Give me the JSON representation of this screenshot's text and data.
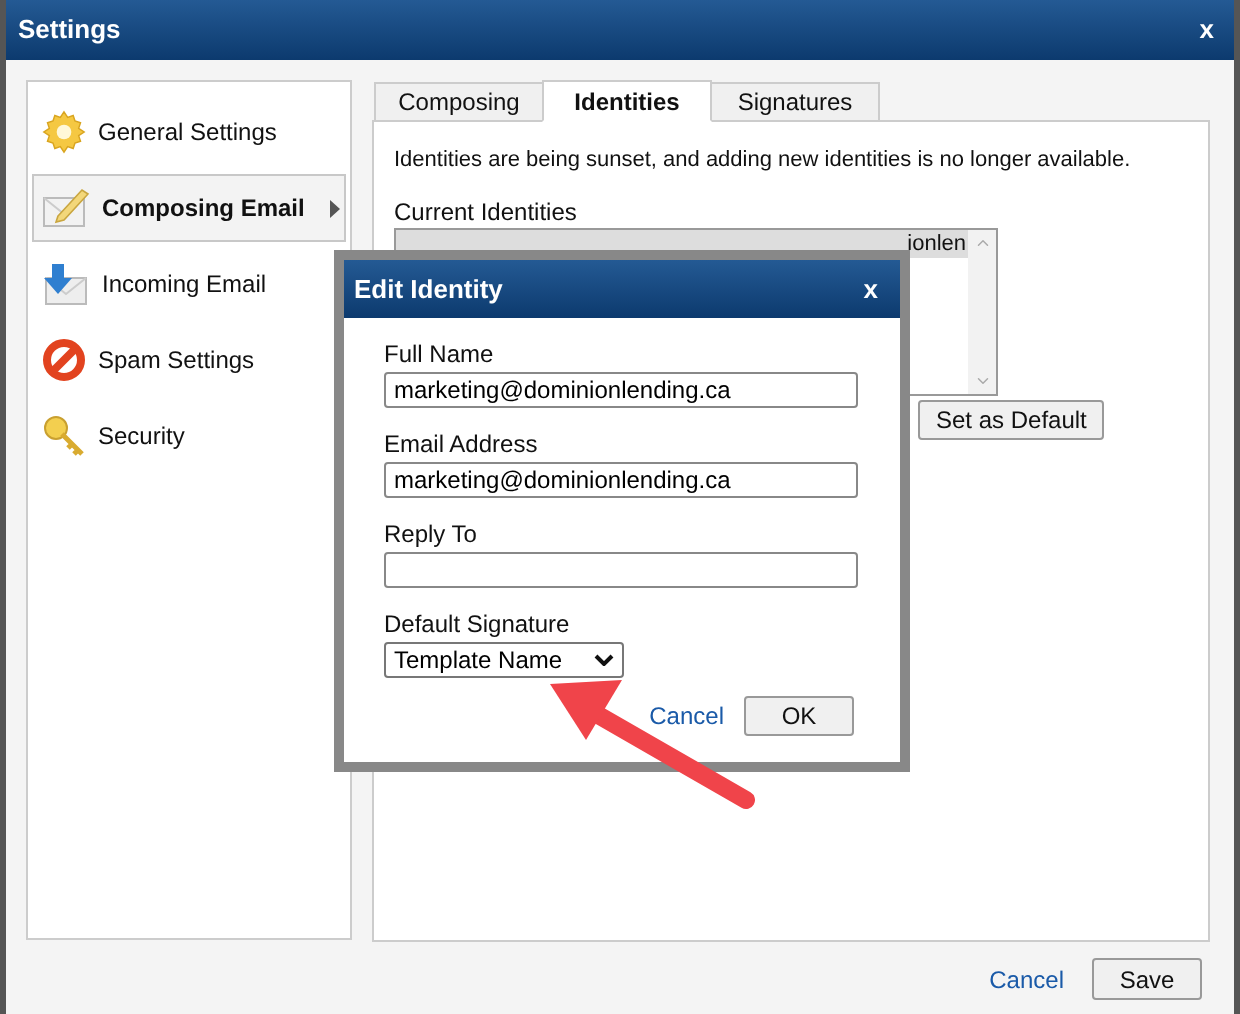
{
  "window": {
    "title": "Settings",
    "close": "x"
  },
  "sidebar": {
    "items": [
      {
        "label": "General Settings",
        "selected": false
      },
      {
        "label": "Composing Email",
        "selected": true
      },
      {
        "label": "Incoming Email",
        "selected": false
      },
      {
        "label": "Spam Settings",
        "selected": false
      },
      {
        "label": "Security",
        "selected": false
      }
    ]
  },
  "tabs": [
    {
      "label": "Composing",
      "selected": false
    },
    {
      "label": "Identities",
      "selected": true
    },
    {
      "label": "Signatures",
      "selected": false
    }
  ],
  "notice": "Identities are being sunset, and adding new identities is no longer available.",
  "identities": {
    "label": "Current Identities",
    "items": [
      {
        "text": "ionlen",
        "selected": true
      }
    ],
    "button": "Set as Default"
  },
  "dialog": {
    "title": "Edit Identity",
    "close": "x",
    "fields": [
      {
        "label": "Full Name",
        "kind": "text",
        "value": "marketing@dominionlending.ca"
      },
      {
        "label": "Email Address",
        "kind": "text",
        "value": "marketing@dominionlending.ca"
      },
      {
        "label": "Reply To",
        "kind": "text"
      },
      {
        "label": "Default Signature",
        "kind": "select",
        "value": "Template Name"
      }
    ],
    "cancel": "Cancel",
    "ok": "OK"
  },
  "footer": {
    "cancel": "Cancel",
    "save": "Save"
  }
}
